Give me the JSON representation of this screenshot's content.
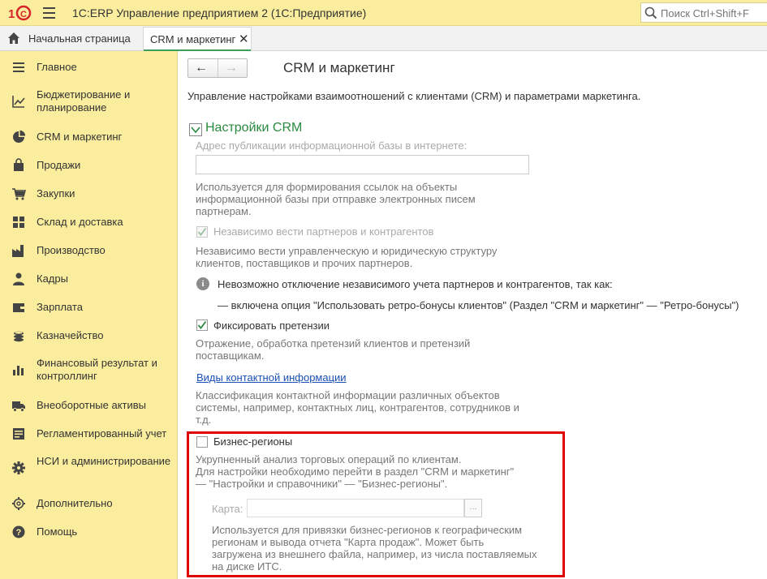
{
  "window": {
    "logo_text": "1С",
    "title": "1С:ERP Управление предприятием 2  (1С:Предприятие)",
    "search_placeholder": "Поиск Ctrl+Shift+F"
  },
  "tabs": {
    "home_label": "Начальная страница",
    "active_label": "CRM и маркетинг",
    "close_glyph": "✕"
  },
  "sidebar": {
    "items": [
      {
        "label": "Главное",
        "icon": "menu-lines-icon"
      },
      {
        "label": "Бюджетирование и планирование",
        "icon": "chart-trend-icon"
      },
      {
        "label": "CRM и маркетинг",
        "icon": "pie-chart-icon"
      },
      {
        "label": "Продажи",
        "icon": "shopping-bag-icon"
      },
      {
        "label": "Закупки",
        "icon": "cart-icon"
      },
      {
        "label": "Склад и доставка",
        "icon": "warehouse-grid-icon"
      },
      {
        "label": "Производство",
        "icon": "factory-icon"
      },
      {
        "label": "Кадры",
        "icon": "person-icon"
      },
      {
        "label": "Зарплата",
        "icon": "wallet-icon"
      },
      {
        "label": "Казначейство",
        "icon": "coins-icon"
      },
      {
        "label": "Финансовый результат и контроллинг",
        "icon": "bar-chart-icon"
      },
      {
        "label": "Внеоборотные активы",
        "icon": "truck-icon"
      },
      {
        "label": "Регламентированный учет",
        "icon": "ledger-icon"
      },
      {
        "label": "НСИ и администрирование",
        "icon": "gear-icon"
      },
      {
        "label": "Дополнительно",
        "icon": "cog-outline-icon"
      },
      {
        "label": "Помощь",
        "icon": "help-icon"
      }
    ]
  },
  "main": {
    "back_glyph": "🡐",
    "forward_glyph": "🡒",
    "title": "CRM и маркетинг",
    "description": "Управление настройками взаимоотношений с клиентами (CRM) и параметрами маркетинга.",
    "section_title": "Настройки CRM",
    "publication_label": "Адрес публикации информационной базы в интернете:",
    "publication_value": "",
    "publication_help": [
      "Используется для формирования ссылок на объекты",
      "информационной базы при отправке электронных писем",
      "партнерам."
    ],
    "independent_partners_label": "Независимо вести партнеров и контрагентов",
    "independent_partners_checked": true,
    "independent_partners_help": [
      "Независимо вести управленческую и юридическую структуру",
      "клиентов, поставщиков и прочих партнеров."
    ],
    "info_glyph": "i",
    "info_text": "Невозможно отключение независимого учета партнеров и контрагентов, так как:",
    "info_detail": "— включена опция \"Использовать ретро-бонусы клиентов\" (Раздел \"CRM и маркетинг\" — \"Ретро-бонусы\")",
    "claims_label": "Фиксировать претензии",
    "claims_checked": true,
    "claims_help": [
      "Отражение, обработка претензий клиентов и претензий",
      "поставщикам."
    ],
    "contact_info_link": "Виды контактной информации",
    "contact_info_help": [
      "Классификация контактной информации различных объектов",
      "системы, например, контактных лиц, контрагентов, сотрудников и",
      "т.д."
    ],
    "business_regions_label": "Бизнес-регионы",
    "business_regions_checked": false,
    "business_regions_help": [
      "Укрупненный анализ торговых операций по клиентам.",
      "Для настройки необходимо перейти в раздел \"CRM и маркетинг\"",
      "— \"Настройки и справочники\" — \"Бизнес-регионы\"."
    ],
    "map_label": "Карта:",
    "map_value": "",
    "map_select_glyph": "...",
    "map_help": [
      "Используется для привязки бизнес-регионов к географическим",
      "регионам и вывода отчета \"Карта продаж\". Может быть",
      "загружена из внешнего файла, например, из числа поставляемых",
      "на диске ИТС."
    ]
  },
  "colors": {
    "panel_yellow": "#fbed9e",
    "section_green": "#2a8a3f",
    "link_blue": "#1a4fb4",
    "highlight_red": "#e00000",
    "logo_red": "#d5262b"
  }
}
